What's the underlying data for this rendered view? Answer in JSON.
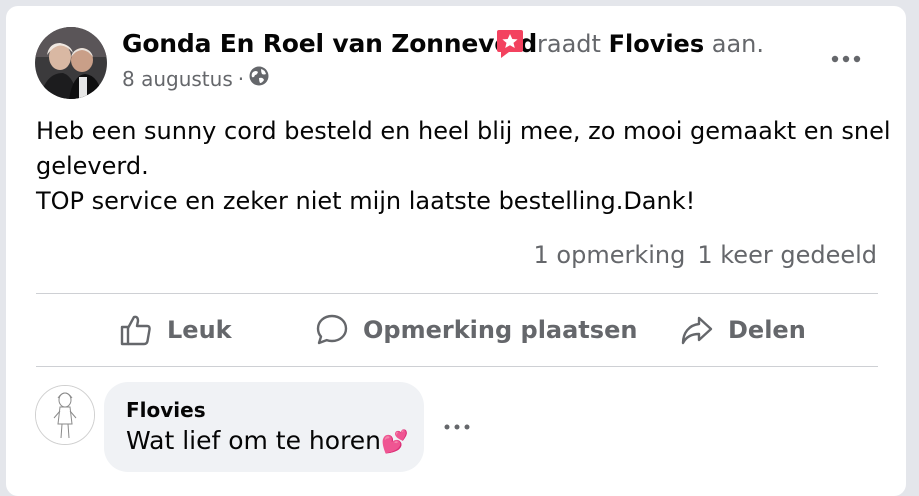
{
  "post": {
    "author": "Gonda En Roel van Zonneveld",
    "recommends_word": "raadt",
    "page_name": "Flovies",
    "recommends_suffix": "aan.",
    "date": "8 augustus",
    "meta_separator": "·",
    "audience_icon": "globe-icon",
    "badge_icon": "recommend-star-icon",
    "text_lines": [
      "Heb een sunny cord besteld en heel blij mee, zo mooi gemaakt en snel",
      "geleverd.",
      "TOP service en zeker niet mijn laatste bestelling.Dank!"
    ]
  },
  "stats": {
    "comments": "1 opmerking",
    "shares": "1 keer gedeeld"
  },
  "actions": {
    "like": "Leuk",
    "comment": "Opmerking plaatsen",
    "share": "Delen"
  },
  "comment": {
    "author": "Flovies",
    "text": "Wat lief om te horen",
    "emoji": "💕"
  },
  "colors": {
    "background": "#e4e6eb",
    "card": "#ffffff",
    "secondary_text": "#65676b",
    "badge": "#f3425f",
    "bubble": "#f0f2f5"
  }
}
